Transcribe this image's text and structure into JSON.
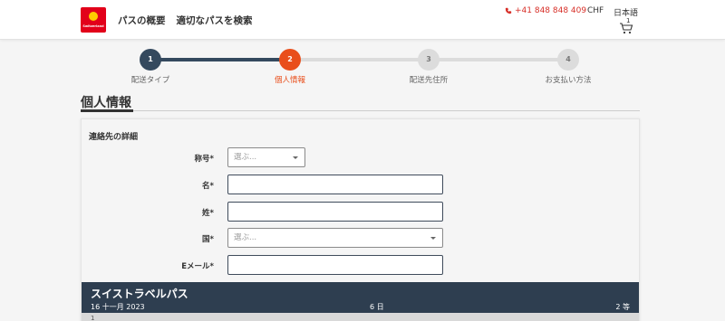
{
  "header": {
    "logo_text": "Switzerland",
    "nav": [
      "パスの概要",
      "適切なパスを検索"
    ],
    "phone": "+41 848 848 409",
    "currency": "CHF",
    "language": "日本語",
    "cart_count": "1"
  },
  "stepper": {
    "steps": [
      {
        "number": "1",
        "label": "配送タイプ",
        "state": "completed"
      },
      {
        "number": "2",
        "label": "個人情報",
        "state": "active"
      },
      {
        "number": "3",
        "label": "配送先住所",
        "state": "upcoming"
      },
      {
        "number": "4",
        "label": "お支払い方法",
        "state": "upcoming"
      }
    ]
  },
  "page_title": "個人情報",
  "contact": {
    "section_title": "連絡先の詳細",
    "fields": {
      "title": {
        "label": "称号*",
        "placeholder": "選ぶ..."
      },
      "first_name": {
        "label": "名*",
        "value": ""
      },
      "last_name": {
        "label": "姓*",
        "value": ""
      },
      "country": {
        "label": "国*",
        "placeholder": "選ぶ..."
      },
      "email": {
        "label": "Eメール*",
        "value": ""
      }
    }
  },
  "pass": {
    "name": "スイストラベルパス",
    "date": "16 十一月 2023",
    "days": "6 日",
    "class": "2 等",
    "subrow": "1"
  },
  "colors": {
    "brand_red": "#e2001a",
    "accent_orange": "#e94e1b",
    "dark_navy": "#34495e",
    "inactive": "#d9d9d9"
  }
}
